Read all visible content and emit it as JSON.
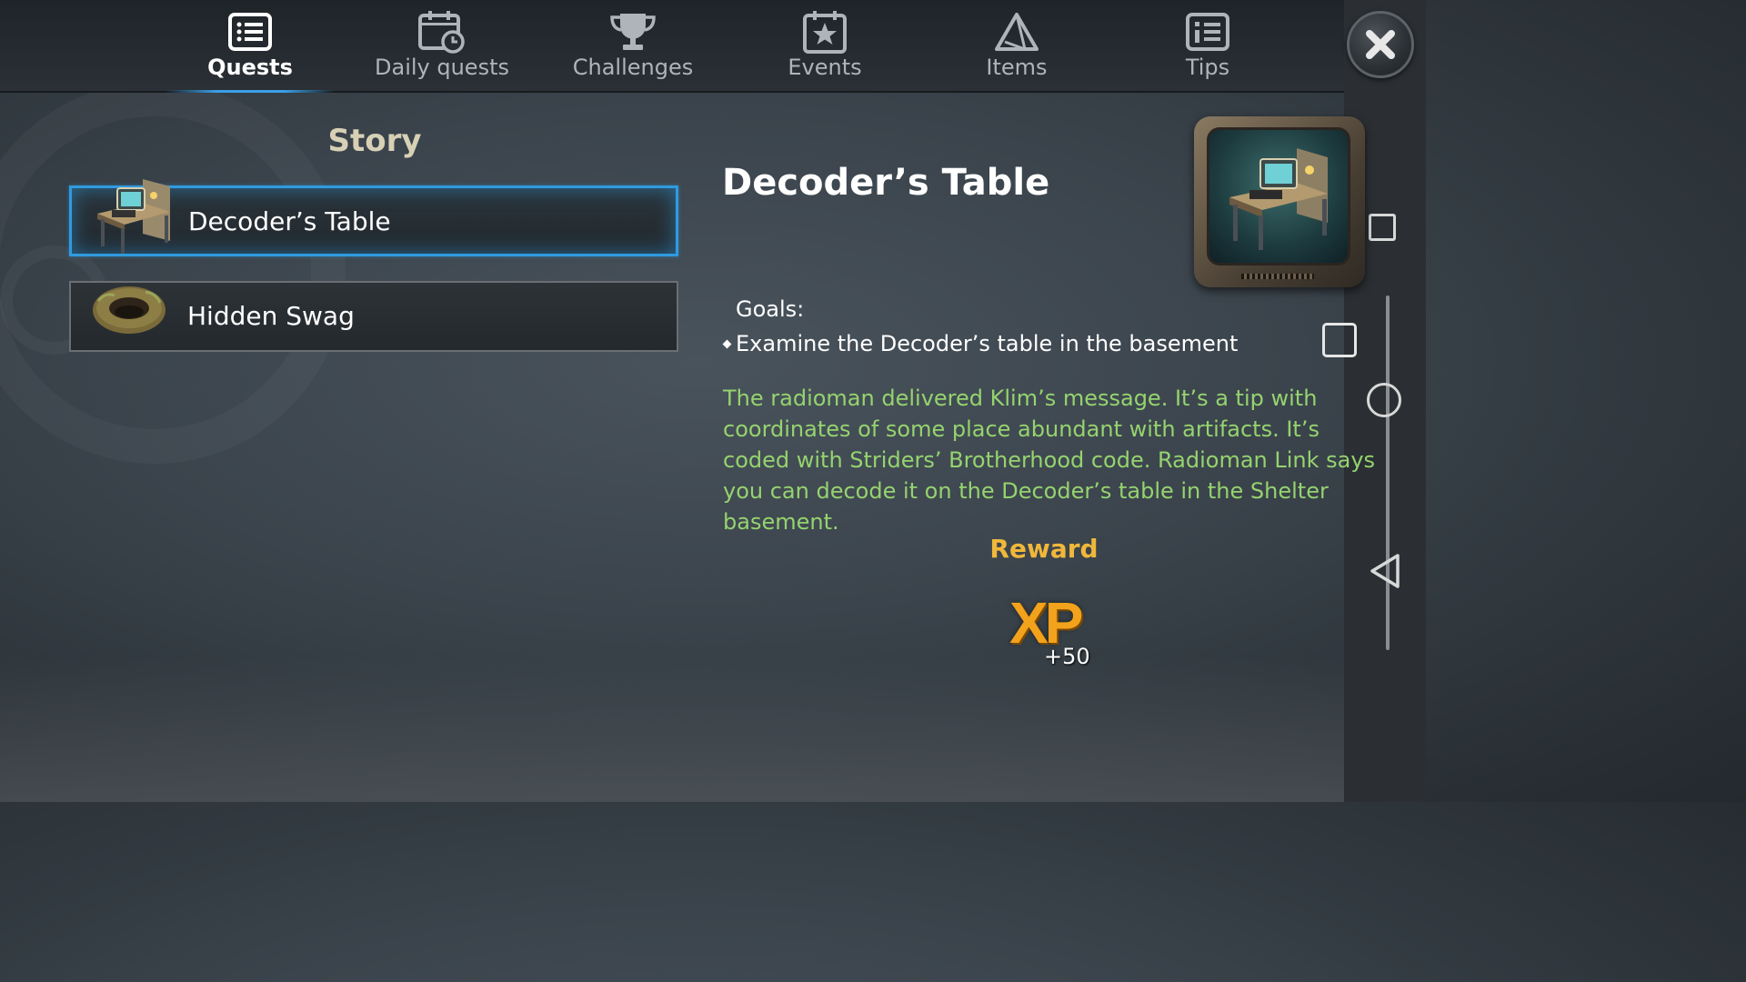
{
  "tabs": [
    {
      "label": "Quests",
      "icon": "quest-list-icon",
      "active": true
    },
    {
      "label": "Daily quests",
      "icon": "calendar-clock-icon",
      "active": false
    },
    {
      "label": "Challenges",
      "icon": "trophy-icon",
      "active": false
    },
    {
      "label": "Events",
      "icon": "calendar-star-icon",
      "active": false
    },
    {
      "label": "Items",
      "icon": "triangle-icon",
      "active": false
    },
    {
      "label": "Tips",
      "icon": "tips-list-icon",
      "active": false
    }
  ],
  "list": {
    "section_title": "Story",
    "items": [
      {
        "name": "Decoder’s Table",
        "icon": "decoder-table-icon",
        "selected": true
      },
      {
        "name": "Hidden Swag",
        "icon": "dirt-hole-icon",
        "selected": false
      }
    ]
  },
  "detail": {
    "title": "Decoder’s Table",
    "goals_label": "Goals:",
    "goals": [
      "Examine the Decoder’s table in the basement"
    ],
    "description": "The radioman delivered Klim’s message. It’s a tip with coordinates of some place abundant with artifacts. It’s coded with Striders’ Brotherhood code. Radioman Link says you can decode it on the Decoder’s table in the Shelter basement.",
    "reward_label": "Reward",
    "reward": {
      "type": "XP",
      "amount": "+50"
    }
  },
  "colors": {
    "accent": "#2f9be0",
    "description_text": "#95d36f",
    "reward_label": "#f0b83a",
    "xp": "#f2a21b"
  }
}
